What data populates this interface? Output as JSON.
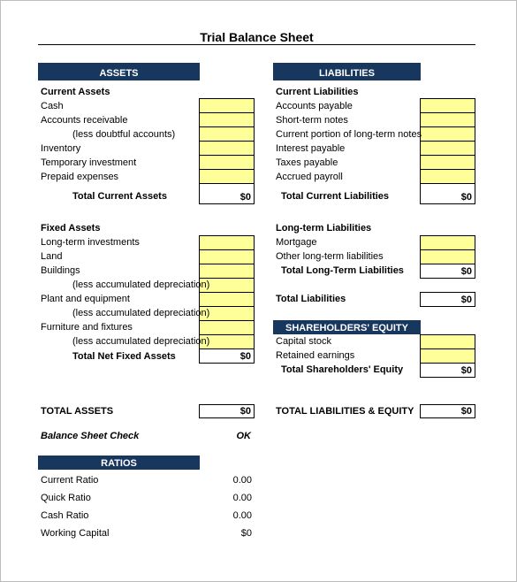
{
  "title": "Trial Balance Sheet",
  "colors": {
    "header_bar": "#17375e",
    "input_cell": "#ffff99"
  },
  "assets": {
    "header": "ASSETS",
    "current": {
      "heading": "Current Assets",
      "items": [
        "Cash",
        "Accounts receivable",
        "(less doubtful accounts)",
        "Inventory",
        "Temporary investment",
        "Prepaid expenses"
      ],
      "total_label": "Total Current Assets",
      "total_value": "$0"
    },
    "fixed": {
      "heading": "Fixed Assets",
      "items": [
        "Long-term investments",
        "Land",
        "Buildings",
        "(less accumulated depreciation)",
        "Plant and equipment",
        "(less accumulated depreciation)",
        "Furniture and fixtures",
        "(less accumulated depreciation)"
      ],
      "total_label": "Total Net Fixed Assets",
      "total_value": "$0"
    },
    "total_label": "TOTAL ASSETS",
    "total_value": "$0"
  },
  "check": {
    "label": "Balance Sheet Check",
    "value": "OK"
  },
  "ratios": {
    "header": "RATIOS",
    "items": [
      {
        "label": "Current Ratio",
        "value": "0.00"
      },
      {
        "label": "Quick Ratio",
        "value": "0.00"
      },
      {
        "label": "Cash Ratio",
        "value": "0.00"
      },
      {
        "label": "Working Capital",
        "value": "$0"
      }
    ]
  },
  "liabilities": {
    "header": "LIABILITIES",
    "current": {
      "heading": "Current Liabilities",
      "items": [
        "Accounts payable",
        "Short-term notes",
        "Current portion of long-term notes",
        "Interest payable",
        "Taxes payable",
        "Accrued payroll"
      ],
      "total_label": "Total Current Liabilities",
      "total_value": "$0"
    },
    "long_term": {
      "heading": "Long-term Liabilities",
      "items": [
        "Mortgage",
        "Other long-term liabilities"
      ],
      "total_label": "Total Long-Term Liabilities",
      "total_value": "$0"
    },
    "total_label": "Total Liabilities",
    "total_value": "$0"
  },
  "equity": {
    "header": "SHAREHOLDERS' EQUITY",
    "items": [
      "Capital stock",
      "Retained earnings"
    ],
    "total_label": "Total Shareholders' Equity",
    "total_value": "$0"
  },
  "grand_total": {
    "label": "TOTAL LIABILITIES & EQUITY",
    "value": "$0"
  }
}
